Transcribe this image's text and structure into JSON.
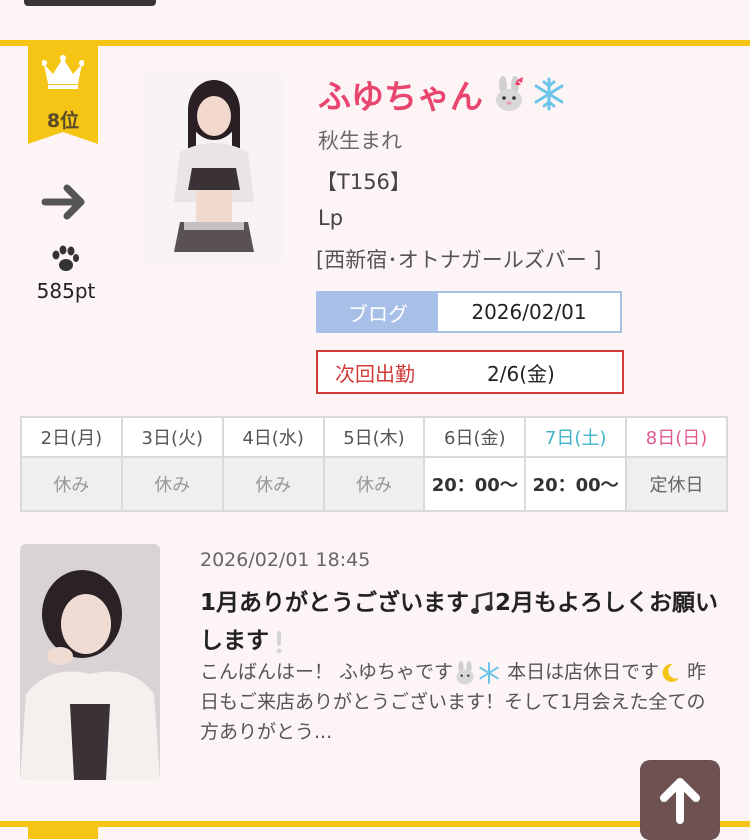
{
  "profile": {
    "rank_label": "8位",
    "points": "585pt",
    "name": "ふゆちゃん",
    "sub_name": "秋生まれ",
    "height": "【T156】",
    "cup": "Lp",
    "shop": "[西新宿･オトナガールズバー ]"
  },
  "blog_info": {
    "label": "ブログ",
    "date": "2026/02/01"
  },
  "next_shift": {
    "label": "次回出勤",
    "date": "2/6(金)"
  },
  "schedule": {
    "days": [
      "2日(月)",
      "3日(火)",
      "4日(水)",
      "5日(木)",
      "6日(金)",
      "7日(土)",
      "8日(日)"
    ],
    "times": [
      "休み",
      "休み",
      "休み",
      "休み",
      "20：00〜",
      "20：00〜",
      "定休日"
    ]
  },
  "post": {
    "date": "2026/02/01 18:45",
    "title_part1": "1月ありがとうございます",
    "title_part2": "2月もよろしくお願いします",
    "excerpt_part1": "こんばんはー！ ふゆちゃです",
    "excerpt_part2": " 本日は店休日です",
    "excerpt_part3": " 昨日もご来店ありがとうございます！そして1月会えた全ての方ありがとう..."
  },
  "colors": {
    "accent_yellow": "#f5c515",
    "name_pink": "#e8456f",
    "blog_blue": "#a8bfe8",
    "next_red": "#d33b3b",
    "saturday": "#3fb3c7",
    "sunday": "#e05a93"
  },
  "icons": [
    "crown-icon",
    "arrow-right-icon",
    "paw-icon",
    "rabbit-emoji-icon",
    "snowflake-emoji-icon",
    "ribbon-icon",
    "music-note-icon",
    "exclamation-icon",
    "moon-icon",
    "arrow-up-icon"
  ]
}
